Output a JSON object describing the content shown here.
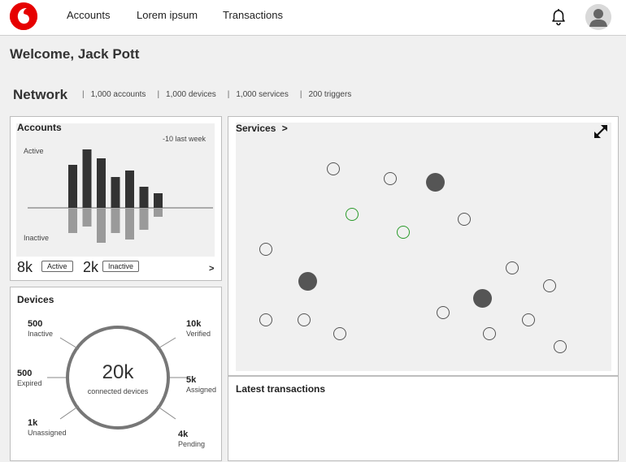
{
  "nav": {
    "logo": "vodafone-logo",
    "items": [
      "Accounts",
      "Lorem ipsum",
      "Transactions"
    ]
  },
  "welcome": "Welcome, Jack Pott",
  "network": {
    "title": "Network",
    "stats": [
      "1,000 accounts",
      "1,000 devices",
      "1,000 services",
      "200 triggers"
    ]
  },
  "accounts": {
    "title": "Accounts",
    "delta": "-10 last week",
    "active_label": "Active",
    "inactive_label": "Inactive",
    "active_value": "8k",
    "active_badge": "Active",
    "inactive_value": "2k",
    "inactive_badge": "Inactive",
    "more": ">"
  },
  "chart_data": {
    "type": "bar",
    "series": [
      {
        "values": [
          53,
          72,
          61,
          38,
          46,
          26,
          18
        ]
      },
      {
        "values": [
          -30,
          -22,
          -42,
          -30,
          -38,
          -26,
          -10
        ]
      }
    ]
  },
  "services": {
    "title": "Services",
    "chevron": ">",
    "expand_icon": "expand-icon"
  },
  "devices": {
    "title": "Devices",
    "center_value": "20k",
    "center_label": "connected devices",
    "stats": [
      {
        "value": "500",
        "label": "Inactive"
      },
      {
        "value": "500",
        "label": "Expired"
      },
      {
        "value": "1k",
        "label": "Unassigned"
      },
      {
        "value": "10k",
        "label": "Verified"
      },
      {
        "value": "5k",
        "label": "Assigned"
      },
      {
        "value": "4k",
        "label": "Pending"
      }
    ]
  },
  "transactions": {
    "title": "Latest transactions"
  }
}
